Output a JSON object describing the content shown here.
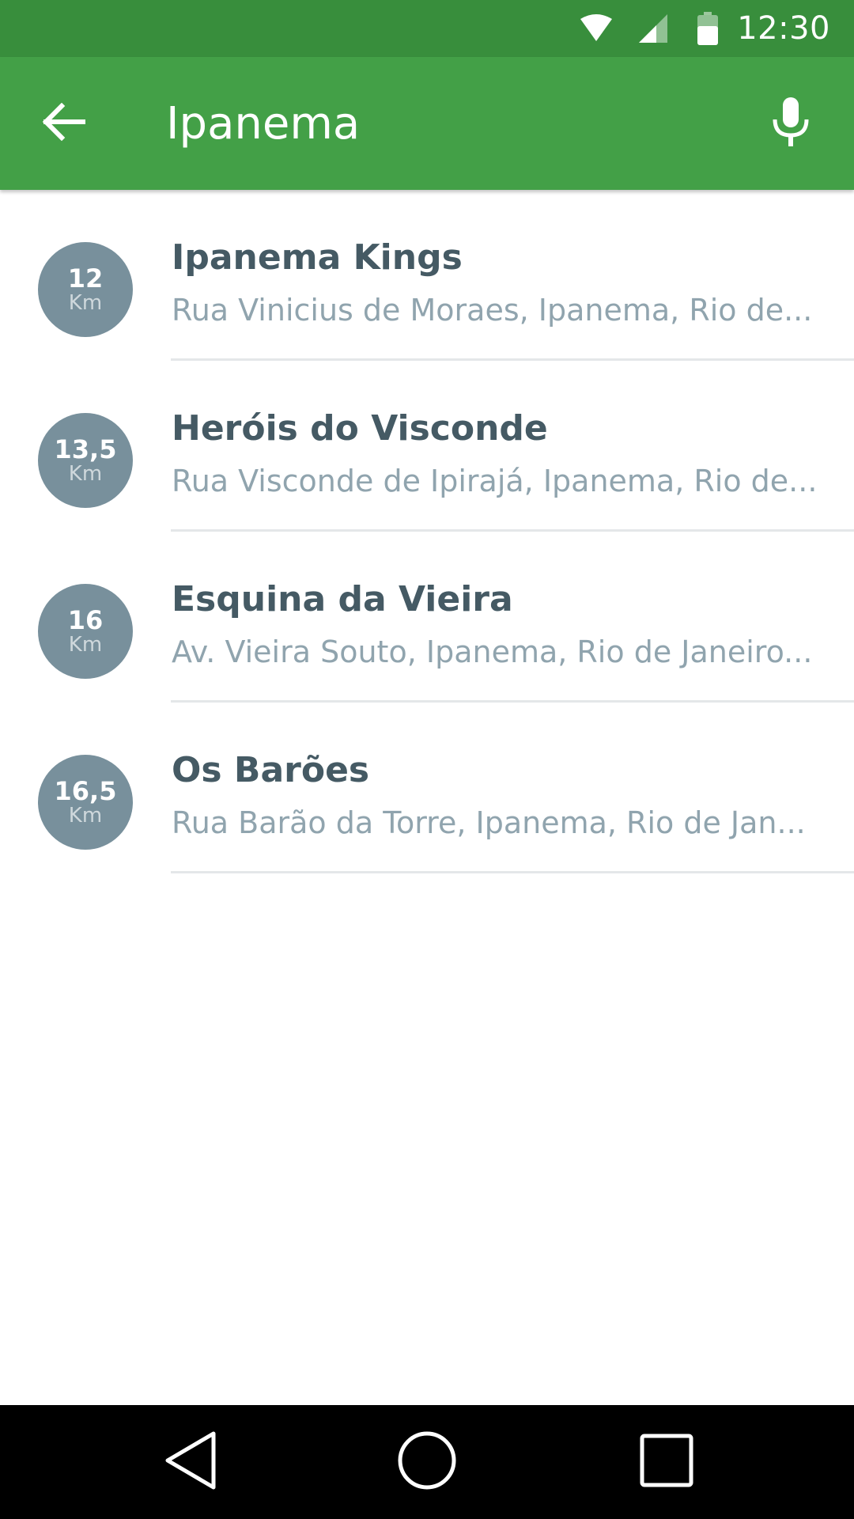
{
  "status_bar": {
    "time": "12:30",
    "icons": [
      "wifi-icon",
      "signal-icon",
      "battery-icon"
    ]
  },
  "toolbar": {
    "back_icon": "arrow-left-icon",
    "search_value": "Ipanema",
    "mic_icon": "microphone-icon"
  },
  "results": [
    {
      "distance": "12",
      "unit": "Km",
      "title": "Ipanema Kings",
      "address": "Rua Vinicius de Moraes, Ipanema, Rio de..."
    },
    {
      "distance": "13,5",
      "unit": "Km",
      "title": "Heróis do Visconde",
      "address": "Rua Visconde de Ipirajá, Ipanema, Rio de..."
    },
    {
      "distance": "16",
      "unit": "Km",
      "title": "Esquina da Vieira",
      "address": "Av. Vieira Souto, Ipanema, Rio de Janeiro..."
    },
    {
      "distance": "16,5",
      "unit": "Km",
      "title": "Os Barões",
      "address": "Rua Barão da Torre, Ipanema, Rio de Jan..."
    }
  ],
  "nav_bar": {
    "icons": [
      "nav-back-icon",
      "home-icon",
      "recents-icon"
    ]
  },
  "colors": {
    "status_bar": "#388E3C",
    "toolbar": "#43A047",
    "badge": "#78909C",
    "title_text": "#455A64",
    "subtitle_text": "#90A4AE"
  }
}
